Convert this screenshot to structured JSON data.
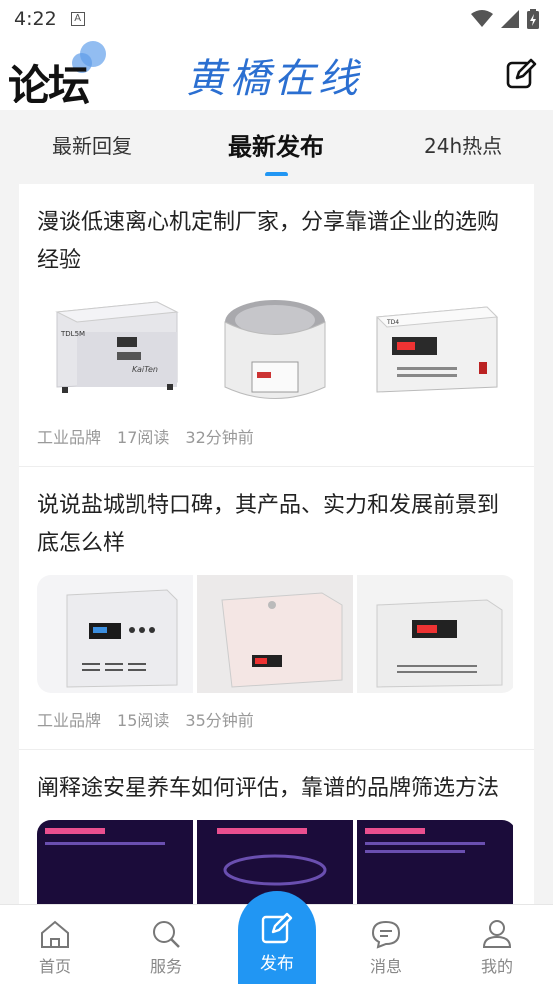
{
  "status_bar": {
    "time": "4:22",
    "notif_icon": "A"
  },
  "header": {
    "title": "论坛",
    "logo_text": "黄橋在线"
  },
  "tabs": [
    {
      "label": "最新回复"
    },
    {
      "label": "最新发布"
    },
    {
      "label": "24h热点"
    }
  ],
  "posts": [
    {
      "title": "漫谈低速离心机定制厂家，分享靠谱企业的选购经验",
      "category": "工业品牌",
      "reads": "17阅读",
      "time": "32分钟前",
      "image_labels": [
        "TDL5M",
        "KaiTen",
        "TD4"
      ]
    },
    {
      "title": "说说盐城凯特口碑，其产品、实力和发展前景到底怎么样",
      "category": "工业品牌",
      "reads": "15阅读",
      "time": "35分钟前"
    },
    {
      "title": "阐释途安星养车如何评估，靠谱的品牌筛选方法"
    }
  ],
  "tabbar": [
    {
      "label": "首页"
    },
    {
      "label": "服务"
    },
    {
      "label": "发布"
    },
    {
      "label": "消息"
    },
    {
      "label": "我的"
    }
  ],
  "colors": {
    "accent": "#2196f3",
    "logo": "#2b6fd1"
  }
}
